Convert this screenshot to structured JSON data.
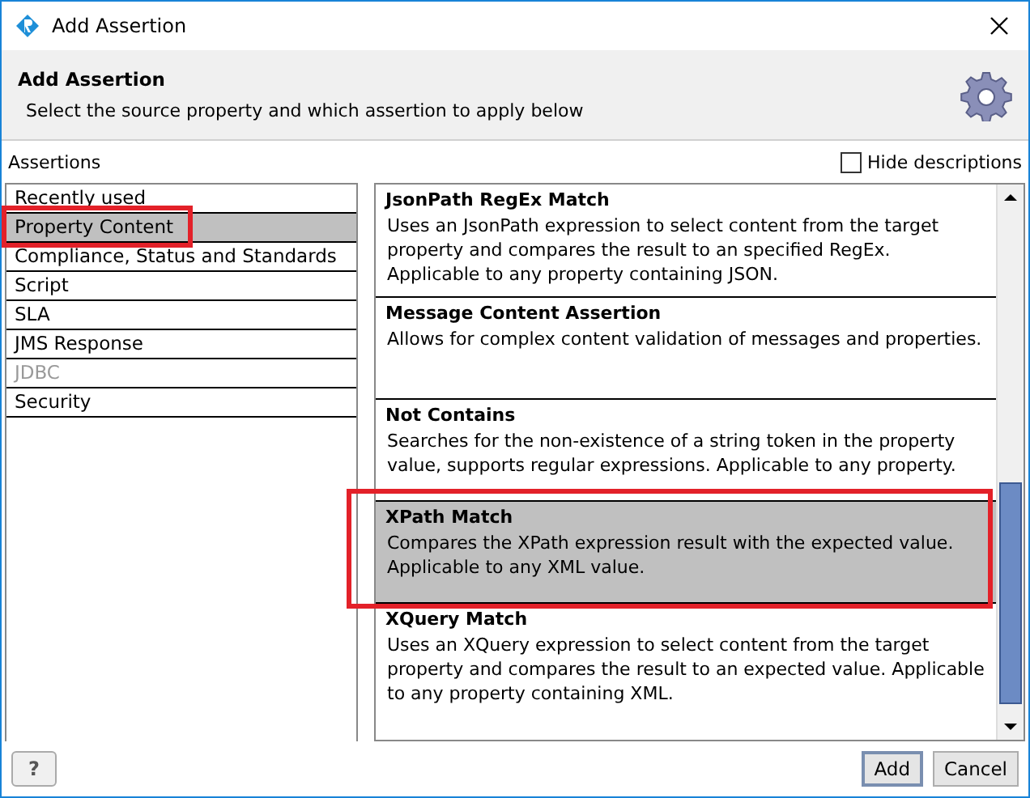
{
  "window": {
    "title": "Add Assertion"
  },
  "header": {
    "title": "Add Assertion",
    "subtitle": "Select the source property and which assertion to apply below"
  },
  "assertions_label": "Assertions",
  "hide_descriptions": {
    "label": "Hide descriptions",
    "checked": false
  },
  "categories": [
    {
      "label": "Recently used",
      "selected": false,
      "disabled": false,
      "marked": false
    },
    {
      "label": "Property Content",
      "selected": true,
      "disabled": false,
      "marked": true
    },
    {
      "label": "Compliance, Status and Standards",
      "selected": false,
      "disabled": false,
      "marked": false
    },
    {
      "label": "Script",
      "selected": false,
      "disabled": false,
      "marked": false
    },
    {
      "label": "SLA",
      "selected": false,
      "disabled": false,
      "marked": false
    },
    {
      "label": "JMS Response",
      "selected": false,
      "disabled": false,
      "marked": false
    },
    {
      "label": "JDBC",
      "selected": false,
      "disabled": true,
      "marked": false
    },
    {
      "label": "Security",
      "selected": false,
      "disabled": false,
      "marked": false
    }
  ],
  "assertion_list": [
    {
      "title": "JsonPath RegEx Match",
      "description": "Uses an JsonPath expression to select content from the target property and compares the result to an specified RegEx. Applicable to any property containing JSON.",
      "selected": false,
      "marked": false
    },
    {
      "title": "Message Content Assertion",
      "description": "Allows for complex content validation of messages and properties.",
      "selected": false,
      "marked": false
    },
    {
      "title": "Not Contains",
      "description": "Searches for the non-existence of a string token in the property value, supports regular expressions. Applicable to any property.",
      "selected": false,
      "marked": false
    },
    {
      "title": "XPath Match",
      "description": "Compares the XPath expression result with the expected value. Applicable to any XML value.",
      "selected": true,
      "marked": true
    },
    {
      "title": "XQuery Match",
      "description": "Uses an XQuery expression to select content from the target property and compares the result to an expected value. Applicable to any property containing XML.",
      "selected": false,
      "marked": false
    }
  ],
  "buttons": {
    "help": "?",
    "add": "Add",
    "cancel": "Cancel"
  }
}
